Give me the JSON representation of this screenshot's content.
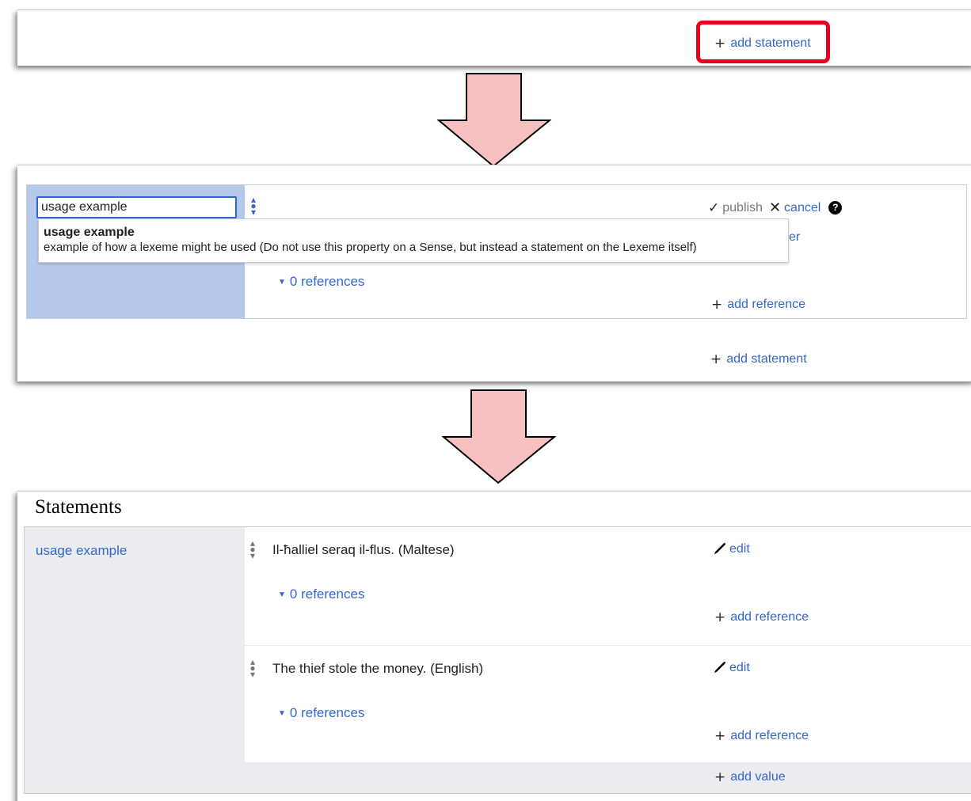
{
  "step1": {
    "add_statement_label": "add statement",
    "highlight_color": "#e8001c"
  },
  "step2": {
    "property_input_value": "usage example",
    "suggestion": {
      "title": "usage example",
      "description": "example of how a lexeme might be used (Do not use this property on a Sense, but instead a statement on the Lexeme itself)"
    },
    "publish_label": "publish",
    "cancel_label": "cancel",
    "help_glyph": "?",
    "hidden_fragment": "er",
    "references_label": "0 references",
    "add_reference_label": "add reference",
    "add_statement_label": "add statement"
  },
  "step3": {
    "heading": "Statements",
    "property_name": "usage example",
    "statements": [
      {
        "value": "Il-ħalliel seraq il-flus. (Maltese)",
        "edit_label": "edit",
        "references_label": "0 references",
        "add_reference_label": "add reference"
      },
      {
        "value": "The thief stole the money. (English)",
        "edit_label": "edit",
        "references_label": "0 references",
        "add_reference_label": "add reference"
      }
    ],
    "add_value_label": "add value"
  },
  "icons": {
    "plus": "plus-icon",
    "check": "check-icon",
    "close": "close-icon",
    "help": "help-icon",
    "pencil": "pencil-icon",
    "rank": "rank-selector-icon",
    "arrow": "down-arrow-icon"
  },
  "colors": {
    "link": "#3366cc",
    "arrow_fill": "#f7c1c1",
    "property_bg": "#b6c8eb",
    "group_bg": "#eaecf0"
  }
}
